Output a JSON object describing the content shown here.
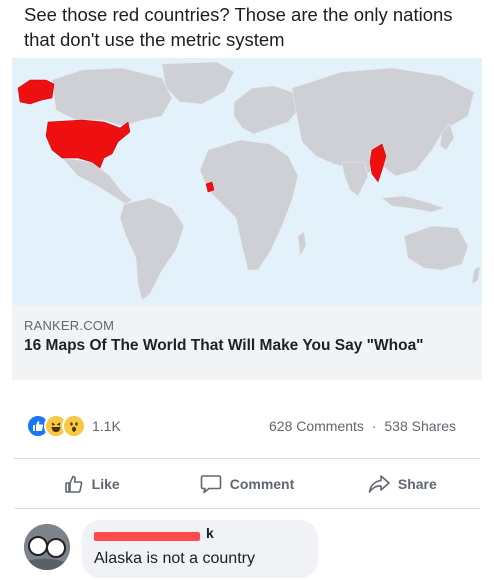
{
  "post": {
    "text": "See those red countries? Those are the only nations that don't use the metric system"
  },
  "link_card": {
    "domain": "RANKER.COM",
    "headline": "16 Maps Of The World That Will Make You Say \"Whoa\"",
    "map": {
      "land_color": "#cfcfd6",
      "ocean_color": "#e3f1fa",
      "highlight_color": "#ee1010",
      "highlighted_regions": [
        "united-states",
        "alaska",
        "liberia",
        "myanmar"
      ]
    }
  },
  "engagement": {
    "reactions": [
      "like-icon",
      "laugh-icon",
      "wow-icon"
    ],
    "reaction_count": "1.1K",
    "comments": "628 Comments",
    "separator": "·",
    "shares": "538 Shares"
  },
  "actions": {
    "like": "Like",
    "comment": "Comment",
    "share": "Share"
  },
  "comment": {
    "author_visible_tail": "k",
    "text": "Alaska is not a country"
  },
  "colors": {
    "redaction": "#ff4b4b",
    "like_blue": "#1877f2",
    "emoji_yellow": "#f7c844"
  }
}
